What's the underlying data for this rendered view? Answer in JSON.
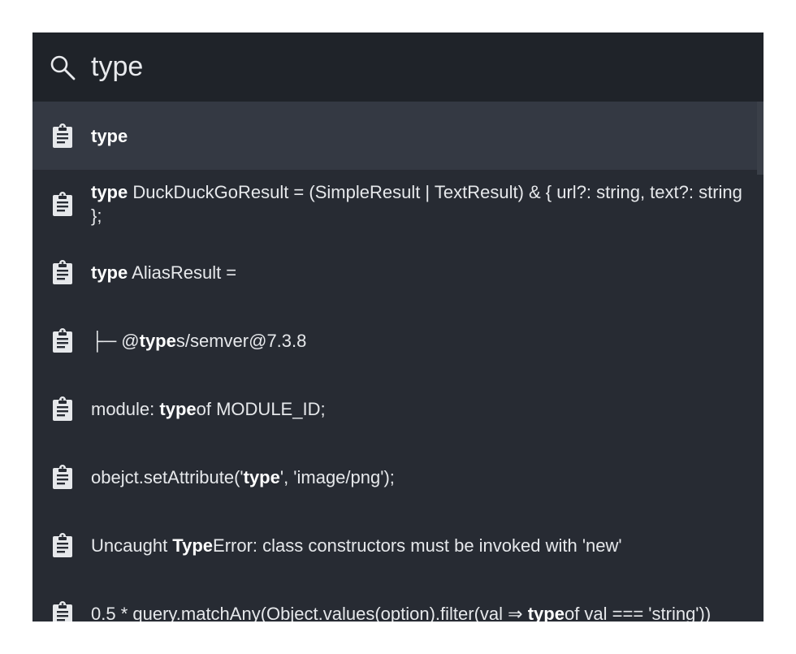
{
  "search": {
    "value": "type",
    "placeholder": ""
  },
  "icons": {
    "search": "search-icon",
    "result": "clipboard-icon"
  },
  "colors": {
    "background": "#272b33",
    "search_bar": "#1f2329",
    "selected_row": "#343943",
    "text": "#e6e8eb"
  },
  "results": [
    {
      "selected": true,
      "segments": [
        {
          "text": "type",
          "bold": true
        }
      ]
    },
    {
      "selected": false,
      "segments": [
        {
          "text": "type",
          "bold": true
        },
        {
          "text": " DuckDuckGoResult = (SimpleResult | TextResult) & { url?: string, text?: string };",
          "bold": false
        }
      ]
    },
    {
      "selected": false,
      "segments": [
        {
          "text": "type",
          "bold": true
        },
        {
          "text": " AliasResult =",
          "bold": false
        }
      ]
    },
    {
      "selected": false,
      "segments": [
        {
          "text": "├─ @",
          "bold": false
        },
        {
          "text": "type",
          "bold": true
        },
        {
          "text": "s/semver@7.3.8",
          "bold": false
        }
      ]
    },
    {
      "selected": false,
      "segments": [
        {
          "text": "module: ",
          "bold": false
        },
        {
          "text": "type",
          "bold": true
        },
        {
          "text": "of MODULE_ID;",
          "bold": false
        }
      ]
    },
    {
      "selected": false,
      "segments": [
        {
          "text": "obejct.setAttribute('",
          "bold": false
        },
        {
          "text": "type",
          "bold": true
        },
        {
          "text": "', 'image/png');",
          "bold": false
        }
      ]
    },
    {
      "selected": false,
      "segments": [
        {
          "text": "Uncaught ",
          "bold": false
        },
        {
          "text": "Type",
          "bold": true
        },
        {
          "text": "Error: class constructors must be invoked with 'new'",
          "bold": false
        }
      ]
    },
    {
      "selected": false,
      "segments": [
        {
          "text": "0.5 * query.matchAny(Object.values(option).filter(val ⇒ ",
          "bold": false
        },
        {
          "text": "type",
          "bold": true
        },
        {
          "text": "of val === 'string'))",
          "bold": false
        }
      ]
    }
  ]
}
